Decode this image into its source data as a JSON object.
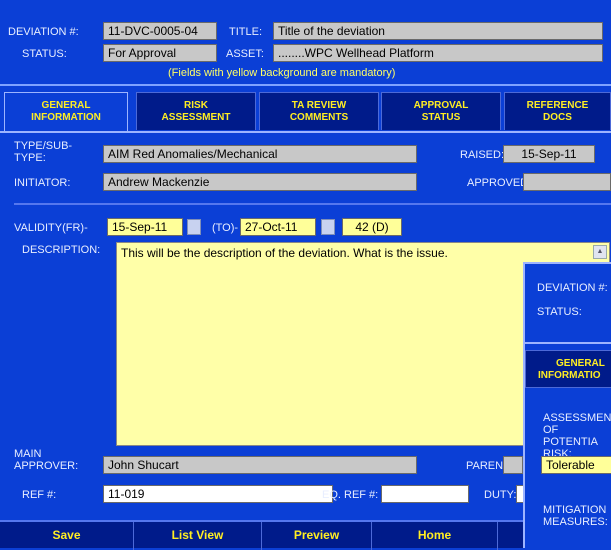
{
  "header": {
    "deviation_label": "DEVIATION #:",
    "deviation_value": "11-DVC-0005-04",
    "title_label": "TITLE:",
    "title_value": "Title of the deviation",
    "status_label": "STATUS:",
    "status_value": "For Approval",
    "asset_label": "ASSET:",
    "asset_value": "........WPC Wellhead Platform",
    "hint": "(Fields with yellow background are mandatory)"
  },
  "tabs": [
    {
      "line1": "GENERAL",
      "line2": "INFORMATION"
    },
    {
      "line1": "RISK",
      "line2": "ASSESSMENT"
    },
    {
      "line1": "TA REVIEW",
      "line2": "COMMENTS"
    },
    {
      "line1": "APPROVAL",
      "line2": "STATUS"
    },
    {
      "line1": "REFERENCE",
      "line2": "DOCS"
    }
  ],
  "general": {
    "type_label": "TYPE/SUB-\nTYPE:",
    "type_value": "AIM Red Anomalies/Mechanical",
    "raised_label": "RAISED:",
    "raised_value": "15-Sep-11",
    "initiator_label": "INITIATOR:",
    "initiator_value": "Andrew Mackenzie",
    "approved_label": "APPROVED:",
    "approved_value": "",
    "validity_label": "VALIDITY(FR)-",
    "validity_from": "15-Sep-11",
    "to_label": "(TO)-",
    "validity_to": "27-Oct-11",
    "duration": "42 (D)",
    "description_label": "DESCRIPTION:",
    "description_value": "This will be the description of the deviation.  What is the issue.",
    "main_approver_label": "MAIN\nAPPROVER:",
    "main_approver_value": "John Shucart",
    "parent_label": "PARENT:",
    "parent_value": "",
    "ref_label": "REF #:",
    "ref_value": "11-019",
    "eq_ref_label": "EQ. REF #:",
    "eq_ref_value": "",
    "duty_label": "DUTY:",
    "duty_value": ""
  },
  "footer": {
    "save": "Save",
    "list_view": "List View",
    "preview": "Preview",
    "home": "Home"
  },
  "popup": {
    "deviation_label": "DEVIATION #:",
    "status_label": "STATUS:",
    "tab_line1": "GENERAL",
    "tab_line2": "INFORMATIO",
    "assessment_label": "ASSESSMEN\nOF POTENTIA\nRISK:",
    "risk_value": "Tolerable",
    "mitigation_label": "MITIGATION\nMEASURES:"
  }
}
